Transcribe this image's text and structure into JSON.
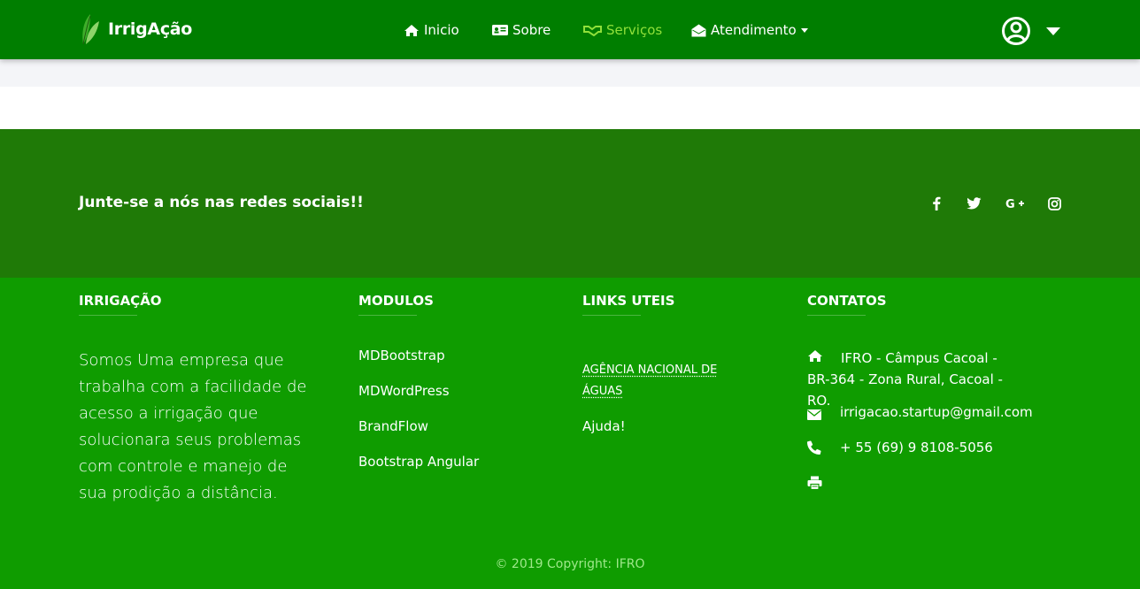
{
  "brand": {
    "name": "IrrigAção"
  },
  "nav": {
    "items": [
      {
        "label": "Inicio",
        "icon": "home-icon"
      },
      {
        "label": "Sobre",
        "icon": "id-card-icon"
      },
      {
        "label": "Serviços",
        "icon": "handshake-icon",
        "active": true
      },
      {
        "label": "Atendimento",
        "icon": "envelope-open-icon",
        "dropdown": true
      }
    ],
    "user_icon": "user-circle-icon"
  },
  "social": {
    "title": "Junte-se a nós nas redes sociais!!",
    "icons": [
      "facebook-icon",
      "twitter-icon",
      "google-plus-icon",
      "instagram-icon"
    ]
  },
  "footer": {
    "about": {
      "title": "IRRIGAÇÃO",
      "text": "Somos Uma empresa que trabalha com a facilidade de acesso a irrigação que solucionara seus problemas com controle e manejo de sua prodição a distância."
    },
    "modules": {
      "title": "MODULOS",
      "links": [
        "MDBootstrap",
        "MDWordPress",
        "BrandFlow",
        "Bootstrap Angular"
      ]
    },
    "useful": {
      "title": "LINKS UTEIS",
      "links": [
        "AGÊNCIA NACIONAL DE ÁGUAS",
        "Ajuda!"
      ]
    },
    "contacts": {
      "title": "CONTATOS",
      "address": "IFRO - Câmpus Cacoal - BR-364 - Zona Rural, Cacoal - RO.",
      "email": "irrigacao.startup@gmail.com",
      "phone": "+ 55 (69) 9 8108-5056"
    },
    "copyright": "© 2019 Copyright: IFRO"
  },
  "colors": {
    "navbar": "#007e00",
    "social_band": "#1f7a07",
    "footer": "#0f9c00",
    "active_nav": "#8fe03a"
  }
}
